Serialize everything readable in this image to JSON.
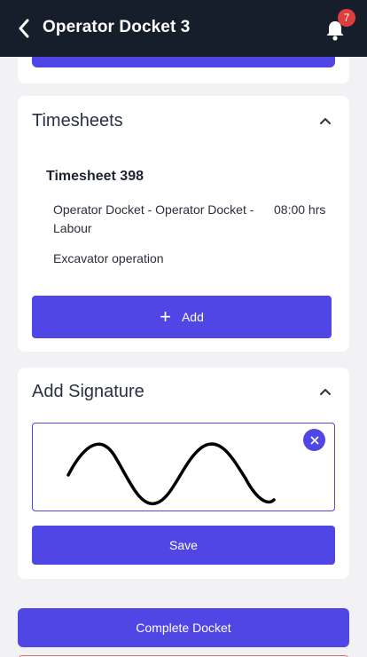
{
  "header": {
    "title": "Operator Docket 3",
    "notification_count": "7"
  },
  "timesheets": {
    "title": "Timesheets",
    "entry": {
      "heading": "Timesheet 398",
      "description": "Operator Docket - Operator Docket - Labour",
      "hours": "08:00 hrs",
      "activity": "Excavator operation"
    },
    "add_label": "Add"
  },
  "signature": {
    "title": "Add Signature",
    "save_label": "Save"
  },
  "footer": {
    "complete_label": "Complete Docket"
  },
  "colors": {
    "accent": "#4f46e5",
    "header_bg": "#161d2b",
    "badge": "#e03e3e"
  }
}
